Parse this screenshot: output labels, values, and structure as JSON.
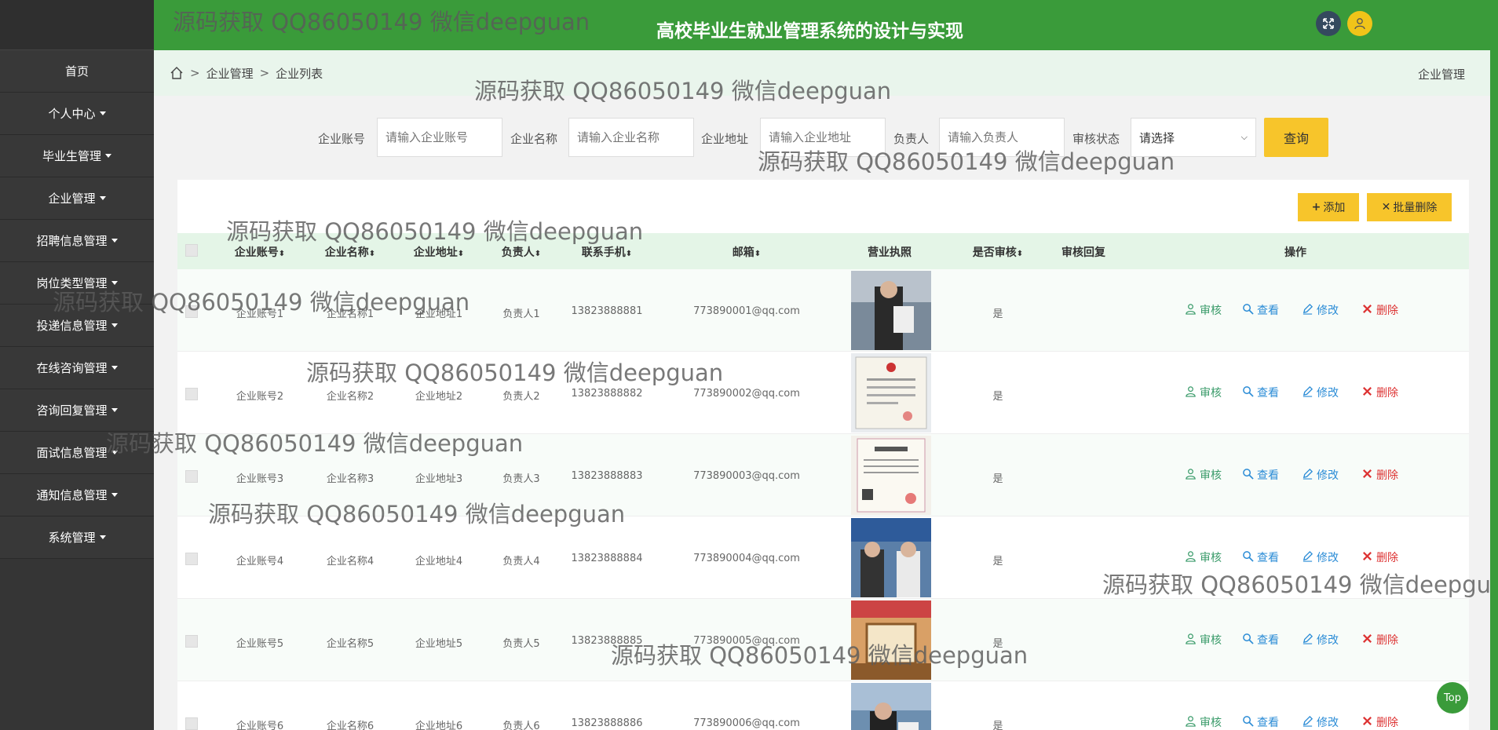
{
  "app": {
    "title": "高校毕业生就业管理系统的设计与实现"
  },
  "sidebar": {
    "items": [
      {
        "label": "首页",
        "has_caret": false
      },
      {
        "label": "个人中心",
        "has_caret": true
      },
      {
        "label": "毕业生管理",
        "has_caret": true
      },
      {
        "label": "企业管理",
        "has_caret": true
      },
      {
        "label": "招聘信息管理",
        "has_caret": true
      },
      {
        "label": "岗位类型管理",
        "has_caret": true
      },
      {
        "label": "投递信息管理",
        "has_caret": true
      },
      {
        "label": "在线咨询管理",
        "has_caret": true
      },
      {
        "label": "咨询回复管理",
        "has_caret": true
      },
      {
        "label": "面试信息管理",
        "has_caret": true
      },
      {
        "label": "通知信息管理",
        "has_caret": true
      },
      {
        "label": "系统管理",
        "has_caret": true
      }
    ]
  },
  "breadcrumb": {
    "sep": ">",
    "level1": "企业管理",
    "level2": "企业列表",
    "right": "企业管理"
  },
  "search": {
    "account_label": "企业账号",
    "account_placeholder": "请输入企业账号",
    "name_label": "企业名称",
    "name_placeholder": "请输入企业名称",
    "address_label": "企业地址",
    "address_placeholder": "请输入企业地址",
    "person_label": "负责人",
    "person_placeholder": "请输入负责人",
    "status_label": "审核状态",
    "status_value": "请选择",
    "query_label": "查询"
  },
  "toolbar": {
    "add_label": "添加",
    "batch_delete_label": "批量删除"
  },
  "table": {
    "headers": {
      "account": "企业账号",
      "name": "企业名称",
      "address": "企业地址",
      "person": "负责人",
      "phone": "联系手机",
      "email": "邮箱",
      "license": "营业执照",
      "audited": "是否审核",
      "reply": "审核回复",
      "actions": "操作"
    },
    "sort_mark": "⬍",
    "actions": {
      "audit": "审核",
      "view": "查看",
      "edit": "修改",
      "delete": "删除"
    },
    "rows": [
      {
        "account": "企业账号1",
        "name": "企业名称1",
        "address": "企业地址1",
        "person": "负责人1",
        "phone": "13823888881",
        "email": "773890001@qq.com",
        "audited": "是",
        "reply": ""
      },
      {
        "account": "企业账号2",
        "name": "企业名称2",
        "address": "企业地址2",
        "person": "负责人2",
        "phone": "13823888882",
        "email": "773890002@qq.com",
        "audited": "是",
        "reply": ""
      },
      {
        "account": "企业账号3",
        "name": "企业名称3",
        "address": "企业地址3",
        "person": "负责人3",
        "phone": "13823888883",
        "email": "773890003@qq.com",
        "audited": "是",
        "reply": ""
      },
      {
        "account": "企业账号4",
        "name": "企业名称4",
        "address": "企业地址4",
        "person": "负责人4",
        "phone": "13823888884",
        "email": "773890004@qq.com",
        "audited": "是",
        "reply": ""
      },
      {
        "account": "企业账号5",
        "name": "企业名称5",
        "address": "企业地址5",
        "person": "负责人5",
        "phone": "13823888885",
        "email": "773890005@qq.com",
        "audited": "是",
        "reply": ""
      },
      {
        "account": "企业账号6",
        "name": "企业名称6",
        "address": "企业地址6",
        "person": "负责人6",
        "phone": "13823888886",
        "email": "773890006@qq.com",
        "audited": "是",
        "reply": ""
      }
    ]
  },
  "watermark": "源码获取 QQ86050149 微信deepguan",
  "top_button": "Top",
  "colors": {
    "header_green": "#3a9b3a",
    "sidebar": "#353535",
    "accent_yellow": "#f7c52b",
    "action_blue": "#2b8cd6",
    "action_red": "#d33333"
  }
}
